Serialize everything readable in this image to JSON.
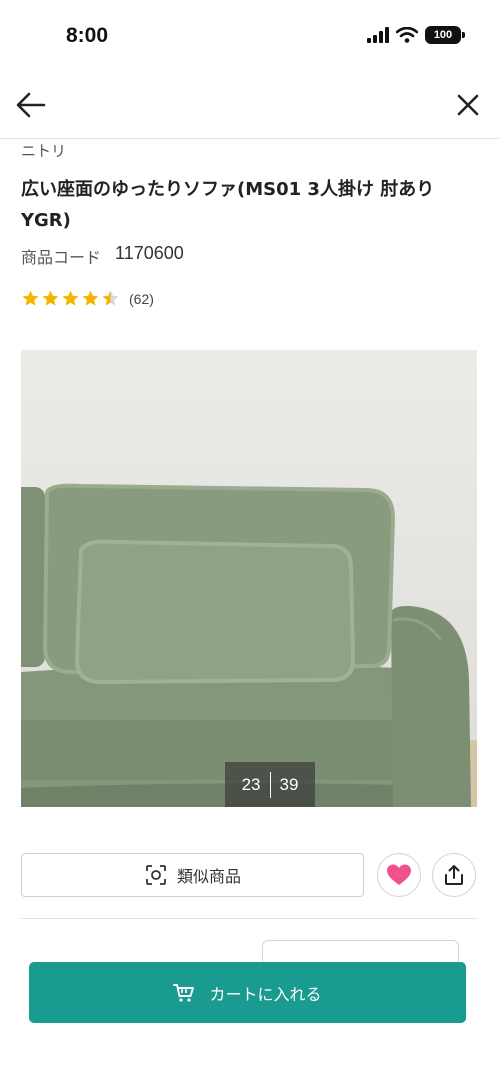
{
  "status_bar": {
    "time": "8:00",
    "battery": "100"
  },
  "nav": {
    "back_icon": "arrow-left-icon",
    "close_icon": "close-icon"
  },
  "product": {
    "brand": "ニトリ",
    "title": "広い座面のゆったりソファ(MS01 3人掛け 肘あり YGR)",
    "code_label": "商品コード",
    "code_value": "1170600",
    "rating": 4.5,
    "review_count": "(62)"
  },
  "gallery": {
    "current": "23",
    "total": "39"
  },
  "actions": {
    "similar_label": "類似商品",
    "similar_icon": "image-search-icon",
    "favorite_icon": "heart-icon",
    "share_icon": "share-icon"
  },
  "cart": {
    "label": "カートに入れる",
    "icon": "cart-icon"
  },
  "colors": {
    "accent": "#1a9b8f",
    "heart": "#f0508c",
    "star": "#f5b400",
    "sofa": "#8a9c80"
  }
}
